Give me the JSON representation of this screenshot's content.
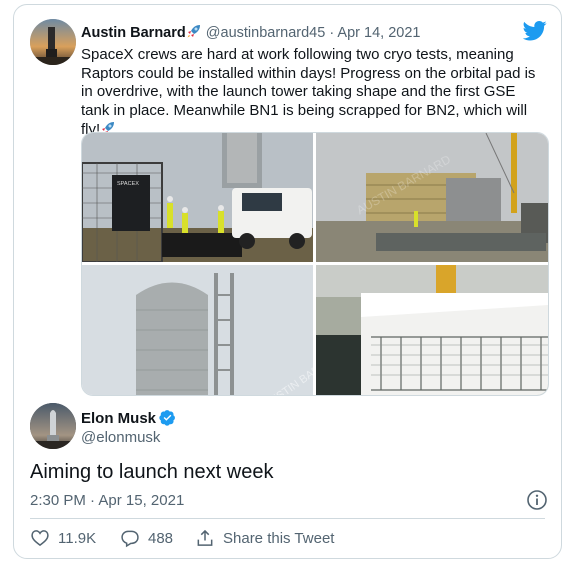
{
  "quoted_tweet": {
    "name": "Austin Barnard",
    "handle": "@austinbarnard45",
    "separator": "·",
    "date": "Apr 14, 2021",
    "text": "SpaceX crews are hard at work following two cryo tests, meaning Raptors could be installed within days! Progress on the orbital pad is in overdrive, with the launch tower taking shape and the first GSE tank in place. Meanwhile BN1 is being scrapped for BN2, which will fly!",
    "media": [
      {
        "icon": "photo-spacex-sign-crew",
        "sign_text": "SPACEX"
      },
      {
        "icon": "photo-stacked-containers"
      },
      {
        "icon": "photo-gse-tank",
        "watermark": "AUSTIN BARNARD"
      },
      {
        "icon": "photo-fenced-structure"
      }
    ]
  },
  "main_tweet": {
    "name": "Elon Musk",
    "handle": "@elonmusk",
    "text": "Aiming to launch next week",
    "time": "2:30 PM",
    "separator": "·",
    "date": "Apr 15, 2021"
  },
  "actions": {
    "likes": "11.9K",
    "replies": "488",
    "share_label": "Share this Tweet"
  },
  "icons": {
    "brand": "twitter-bird-icon",
    "verified": "verified-badge-icon",
    "info": "info-icon",
    "like": "heart-icon",
    "reply": "reply-icon",
    "share": "share-icon",
    "emoji": "rocket-emoji-icon"
  },
  "colors": {
    "brand": "#1d9bf0",
    "text": "#0f1419",
    "muted": "#536471",
    "border": "#cfd9de"
  }
}
